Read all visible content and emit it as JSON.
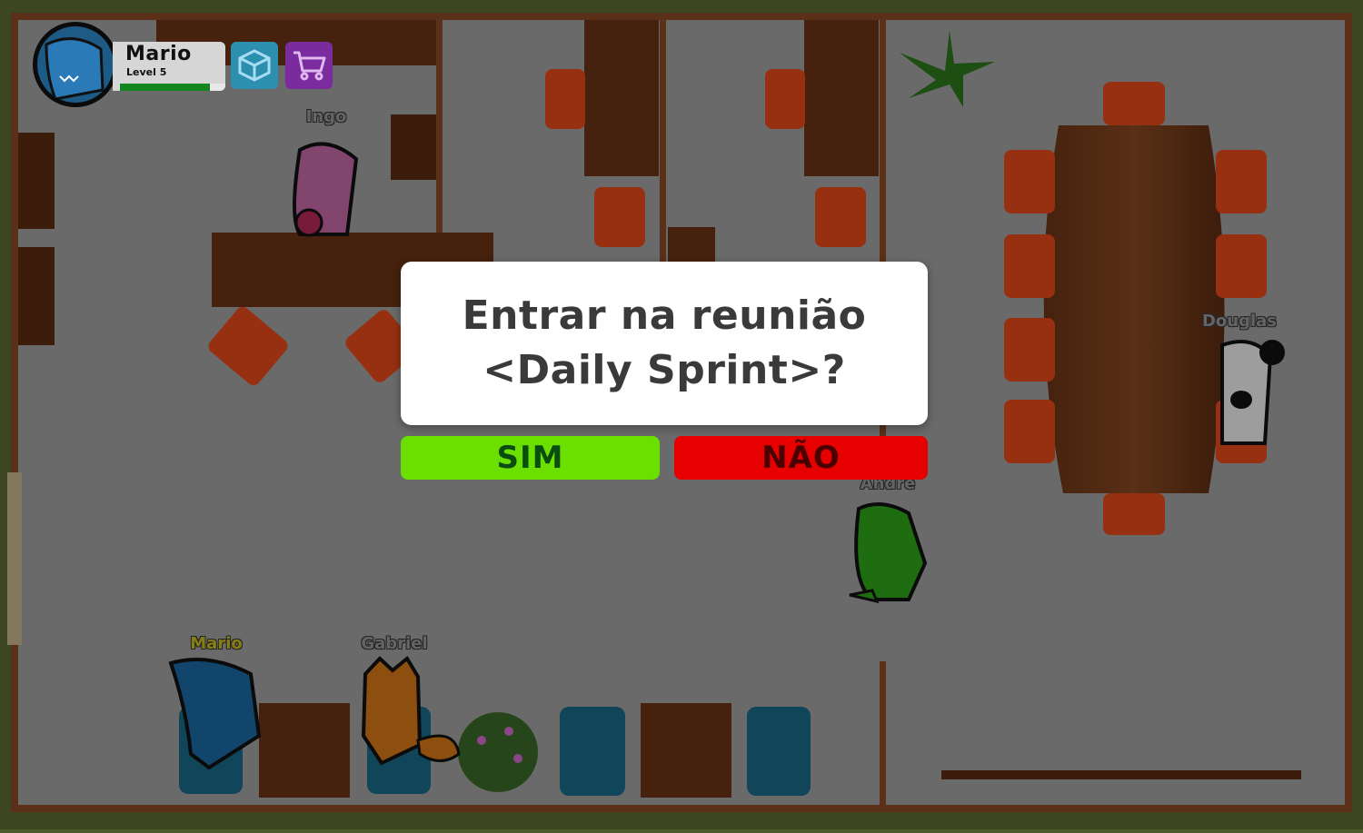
{
  "hud": {
    "player_name": "Mario",
    "player_level": "Level 5",
    "xp_progress": 0.85,
    "inventory_icon": "box-icon",
    "shop_icon": "cart-icon"
  },
  "dialog": {
    "line1": "Entrar na reunião",
    "line2": "<Daily Sprint>?",
    "yes_label": "SIM",
    "no_label": "NÃO"
  },
  "characters": [
    {
      "name": "Ingo",
      "color": "#c86aa8"
    },
    {
      "name": "Douglas",
      "color": "#2a2a2a"
    },
    {
      "name": "Andre",
      "color": "#2fa81a"
    },
    {
      "name": "Mario",
      "color": "#1d6aa5"
    },
    {
      "name": "Gabriel",
      "color": "#d87a1a"
    }
  ],
  "colors": {
    "accent_yes": "#6be000",
    "accent_no": "#e60000",
    "floor": "#9a9a9a",
    "wall": "#6b3a1e",
    "chair": "#e84a1a"
  }
}
